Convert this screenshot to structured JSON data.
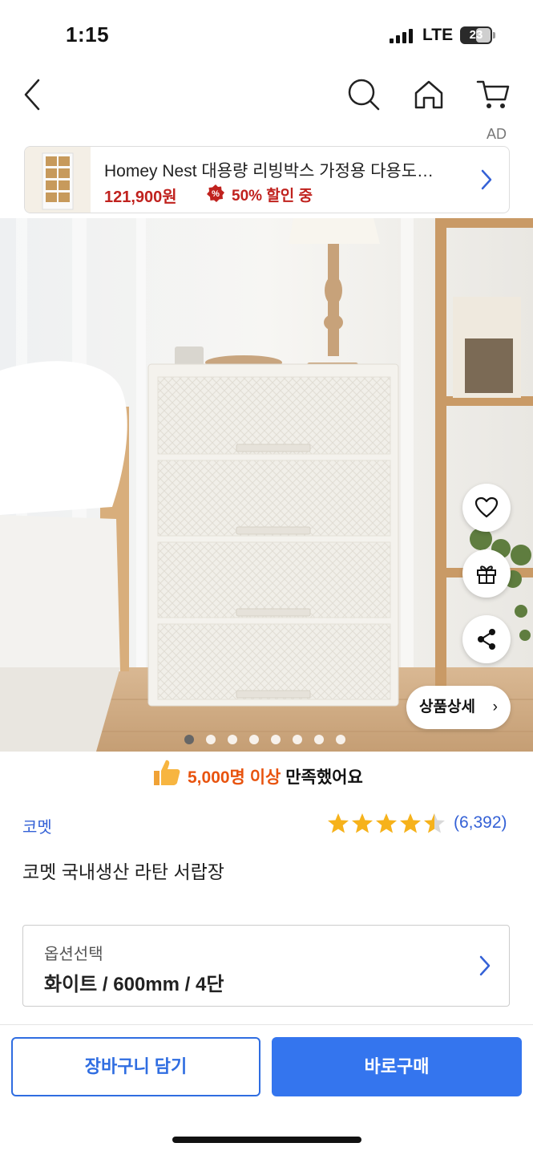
{
  "status": {
    "time": "1:15",
    "network": "LTE",
    "battery": "23"
  },
  "nav": {
    "icons": [
      "back-icon",
      "search-icon",
      "home-icon",
      "cart-icon"
    ]
  },
  "ad": {
    "label": "AD",
    "title": "Homey Nest 대용량 리빙박스 가정용 다용도…",
    "price": "121,900원",
    "discount": "50% 할인 중"
  },
  "hero": {
    "image": "white rattan 4-drawer chest in bedroom",
    "detail_button": "상품상세",
    "detail_chevron": "›",
    "slide_count": 8,
    "active_slide": 1
  },
  "satisfaction": {
    "highlight": "5,000명 이상",
    "rest": "만족했어요"
  },
  "product": {
    "brand": "코멧",
    "rating": 4.5,
    "rating_count": "(6,392)",
    "title": "코멧 국내생산 라탄 서랍장"
  },
  "option": {
    "label": "옵션선택",
    "value": "화이트 / 600mm / 4단"
  },
  "actions": {
    "cart": "장바구니 담기",
    "buy": "바로구매"
  },
  "colors": {
    "accent": "#3475ee",
    "brand_link": "#3461d6",
    "sale": "#c0221e",
    "orange": "#e8530e"
  }
}
